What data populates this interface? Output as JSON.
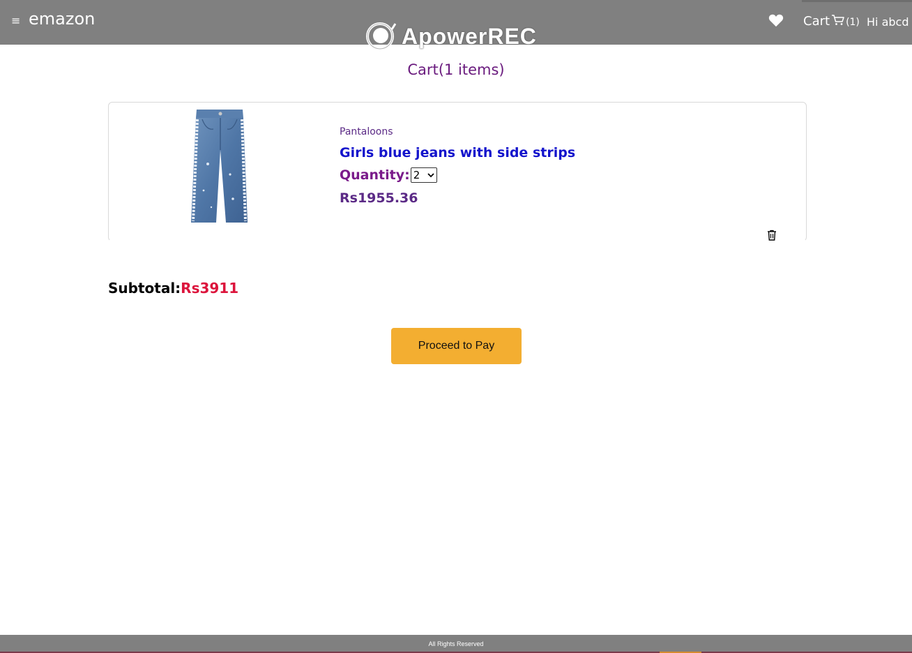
{
  "header": {
    "menu_icon": "hamburger-icon",
    "brand": "emazon",
    "watermark": "ApowerREC",
    "wishlist_icon": "heart-icon",
    "cart_label": "Cart",
    "cart_icon": "cart-icon",
    "cart_count": "(1)",
    "greeting": "Hi abcd"
  },
  "cart": {
    "title": "Cart(1 items)",
    "items": [
      {
        "brand": "Pantaloons",
        "name": "Girls blue jeans with side strips",
        "quantity_label": "Quantity:",
        "quantity_value": "2",
        "price": "Rs1955.36",
        "image": "jeans-image",
        "delete_icon": "trash-icon"
      }
    ],
    "subtotal_label": "Subtotal:",
    "subtotal_value": "Rs3911",
    "pay_button": "Proceed to Pay"
  },
  "footer": {
    "text": "All Rights Reserved"
  },
  "colors": {
    "header_bg": "#808080",
    "title_purple": "#6a1b7e",
    "product_link_blue": "#1414cc",
    "subtotal_red": "#dc143c",
    "pay_button": "#f3ae31"
  }
}
